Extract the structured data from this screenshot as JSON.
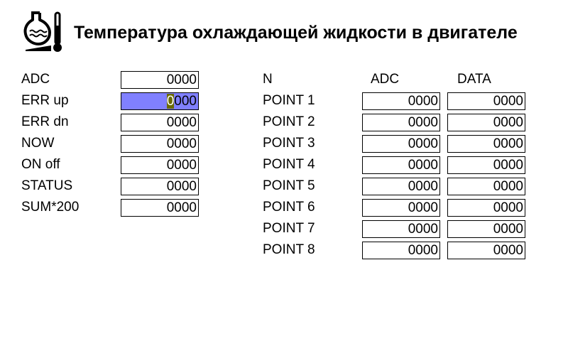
{
  "header": {
    "icon": "engine-coolant-temperature-icon",
    "title": "Температура охлаждающей жидкости в двигателе"
  },
  "params": [
    {
      "label": "ADC",
      "value": "0000"
    },
    {
      "label": "ERR up",
      "value": "0000",
      "selected": true,
      "cursor_char": "0",
      "rest": "000"
    },
    {
      "label": "ERR dn",
      "value": "0000"
    },
    {
      "label": "NOW",
      "value": "0000"
    },
    {
      "label": "ON off",
      "value": "0000"
    },
    {
      "label": "STATUS",
      "value": "0000"
    },
    {
      "label": "SUM*200",
      "value": "0000"
    }
  ],
  "points_table": {
    "headers": [
      "N",
      "ADC",
      "DATA"
    ],
    "rows": [
      {
        "name": "POINT 1",
        "adc": "0000",
        "data": "0000"
      },
      {
        "name": "POINT 2",
        "adc": "0000",
        "data": "0000"
      },
      {
        "name": "POINT 3",
        "adc": "0000",
        "data": "0000"
      },
      {
        "name": "POINT 4",
        "adc": "0000",
        "data": "0000"
      },
      {
        "name": "POINT 5",
        "adc": "0000",
        "data": "0000"
      },
      {
        "name": "POINT 6",
        "adc": "0000",
        "data": "0000"
      },
      {
        "name": "POINT 7",
        "adc": "0000",
        "data": "0000"
      },
      {
        "name": "POINT 8",
        "adc": "0000",
        "data": "0000"
      }
    ]
  },
  "colors": {
    "selected_field": "#8080ff",
    "cursor": "#6b6b00"
  }
}
